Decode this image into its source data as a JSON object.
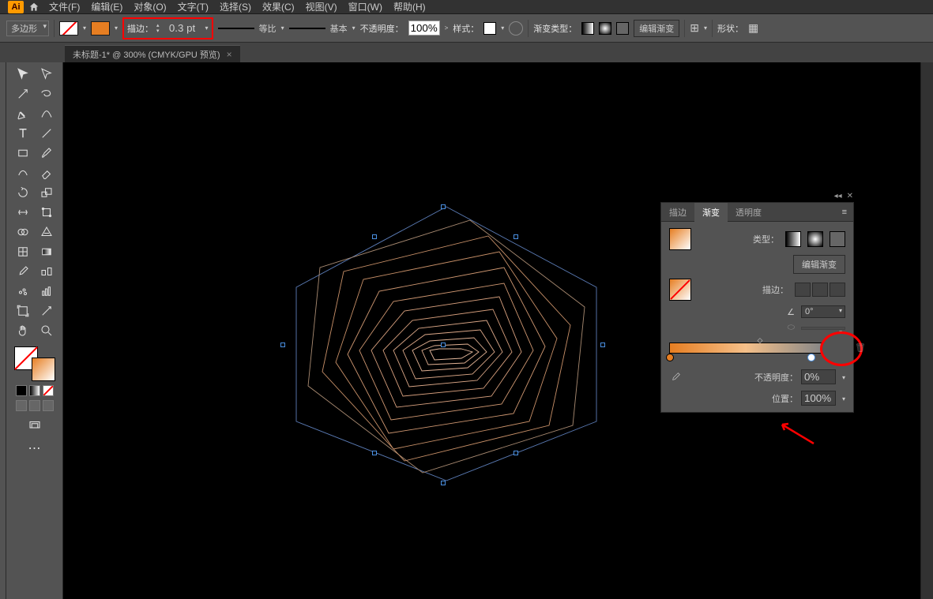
{
  "menu": {
    "items": [
      "文件(F)",
      "编辑(E)",
      "对象(O)",
      "文字(T)",
      "选择(S)",
      "效果(C)",
      "视图(V)",
      "窗口(W)",
      "帮助(H)"
    ]
  },
  "options": {
    "shapeTool": "多边形",
    "strokeLabel": "描边：",
    "strokeWeight": "0.3 pt",
    "uniformLabel": "等比",
    "basicLabel": "基本",
    "opacityLabel": "不透明度：",
    "opacityValue": "100%",
    "styleLabel": "样式：",
    "gradTypeLabel": "渐变类型：",
    "editGradLabel": "编辑渐变",
    "shapeLabel": "形状："
  },
  "docTab": {
    "title": "未标题-1* @ 300% (CMYK/GPU 预览)"
  },
  "panel": {
    "tabs": {
      "stroke": "描边",
      "gradient": "渐变",
      "transparency": "透明度"
    },
    "typeLabel": "类型：",
    "editGradient": "编辑渐变",
    "strokeLabel": "描边：",
    "angle": "0°",
    "opacityLabel": "不透明度：",
    "opacityValue": "0%",
    "positionLabel": "位置：",
    "positionValue": "100%"
  },
  "chart_data": null
}
